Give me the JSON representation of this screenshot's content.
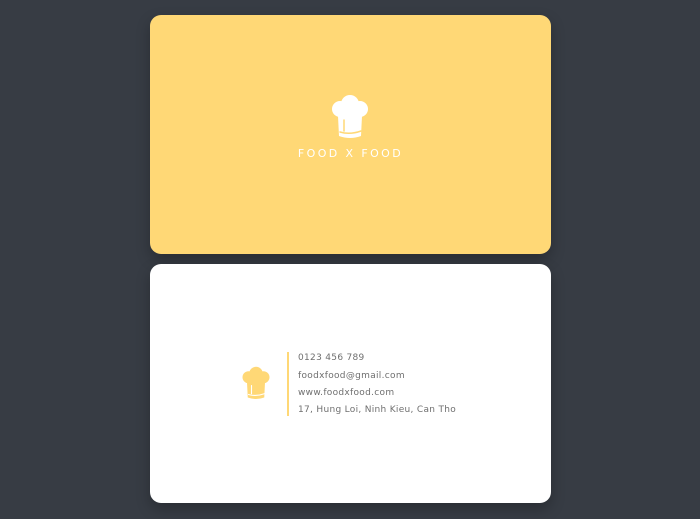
{
  "colors": {
    "background": "#373c44",
    "card_front": "#ffd876",
    "card_back": "#ffffff",
    "accent": "#ffd876",
    "text": "#6f6f6f"
  },
  "front": {
    "logo_icon": "chef-hat-icon",
    "brand_name": "FOOD X FOOD"
  },
  "back": {
    "logo_icon": "chef-hat-icon",
    "phone": "0123 456 789",
    "email": "foodxfood@gmail.com",
    "website": "www.foodxfood.com",
    "address": "17, Hung Loi, Ninh Kieu, Can Tho"
  }
}
